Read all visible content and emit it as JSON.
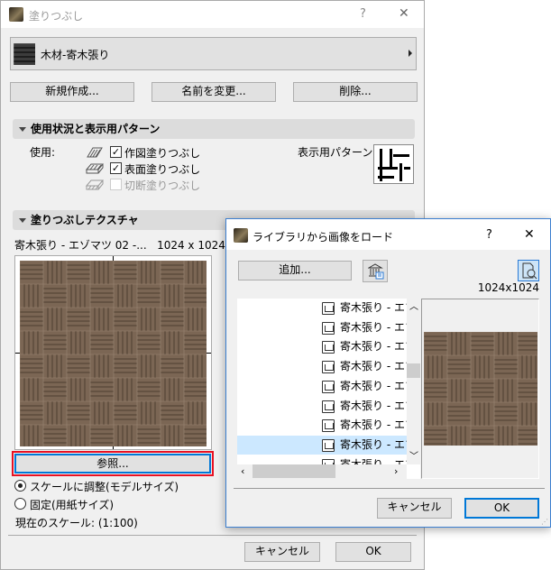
{
  "main": {
    "title": "塗りつぶし",
    "help": "?",
    "close": "✕",
    "fill_name": "木材-寄木張り",
    "buttons": {
      "new": "新規作成...",
      "rename": "名前を変更...",
      "delete": "削除..."
    },
    "usage_section": "使用状況と表示用パターン",
    "usage_label": "使用:",
    "usage": [
      {
        "label": "作図塗りつぶし",
        "checked": true,
        "enabled": true
      },
      {
        "label": "表面塗りつぶし",
        "checked": true,
        "enabled": true
      },
      {
        "label": "切断塗りつぶし",
        "checked": false,
        "enabled": false
      }
    ],
    "display_pattern_label": "表示用パターン:",
    "texture_section": "塗りつぶしテクスチャ",
    "texture_name": "寄木張り - エゾマツ 02 -...   1024 x 1024)",
    "browse": "参照...",
    "radio_scale": "スケールに調整(モデルサイズ)",
    "radio_fixed": "固定(用紙サイズ)",
    "current_scale": "現在のスケール: (1:100)",
    "cancel": "キャンセル",
    "ok": "OK"
  },
  "dialog": {
    "title": "ライブラリから画像をロード",
    "help": "?",
    "close": "✕",
    "add": "追加...",
    "size": "1024x1024",
    "items": [
      "寄木張り - エゾマツ",
      "寄木張り - エゾマツ",
      "寄木張り - エゾマツ",
      "寄木張り - エゾマツ",
      "寄木張り - エゾマツ",
      "寄木張り - エゾマツ",
      "寄木張り - エゾマツ",
      "寄木張り - エゾマツ",
      "寄木張り - エゾマツ"
    ],
    "selected_index": 7,
    "cancel": "キャンセル",
    "ok": "OK"
  },
  "colors": {
    "accent": "#0078d7",
    "highlight": "#cce8ff",
    "focus_red": "#e81123"
  }
}
